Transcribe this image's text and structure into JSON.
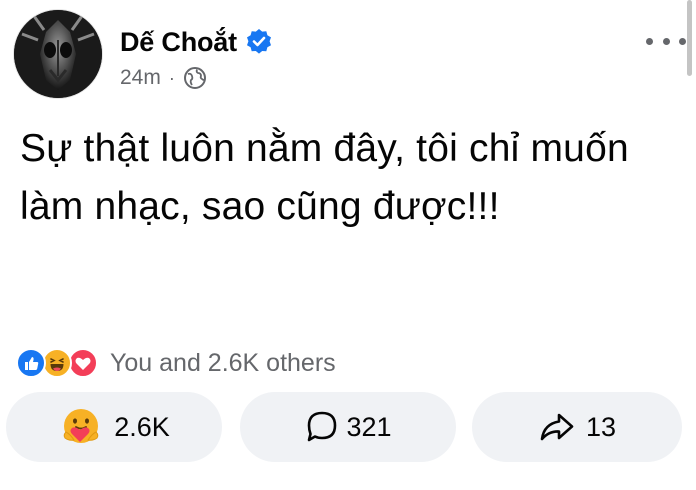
{
  "post": {
    "author": "Dế Choắt",
    "timestamp": "24m",
    "separator": "·",
    "text": "Sự thật luôn nằm đây, tôi chỉ muốn làm nhạc, sao cũng được!!!",
    "audience_icon": "globe-icon",
    "verified_icon": "verified-badge-icon"
  },
  "reactions": {
    "summary": "You and 2.6K others",
    "icons": [
      "like-icon",
      "haha-icon",
      "love-icon"
    ]
  },
  "actions": {
    "reaction": {
      "icon": "care-icon",
      "count": "2.6K"
    },
    "comment": {
      "icon": "comment-icon",
      "count": "321"
    },
    "share": {
      "icon": "share-icon",
      "count": "13"
    }
  },
  "colors": {
    "verified": "#1877f2",
    "like": "#1877f2",
    "love": "#f33e58",
    "haha": "#f7b125",
    "secondary_text": "#65676b",
    "button_bg": "#f0f2f5"
  }
}
